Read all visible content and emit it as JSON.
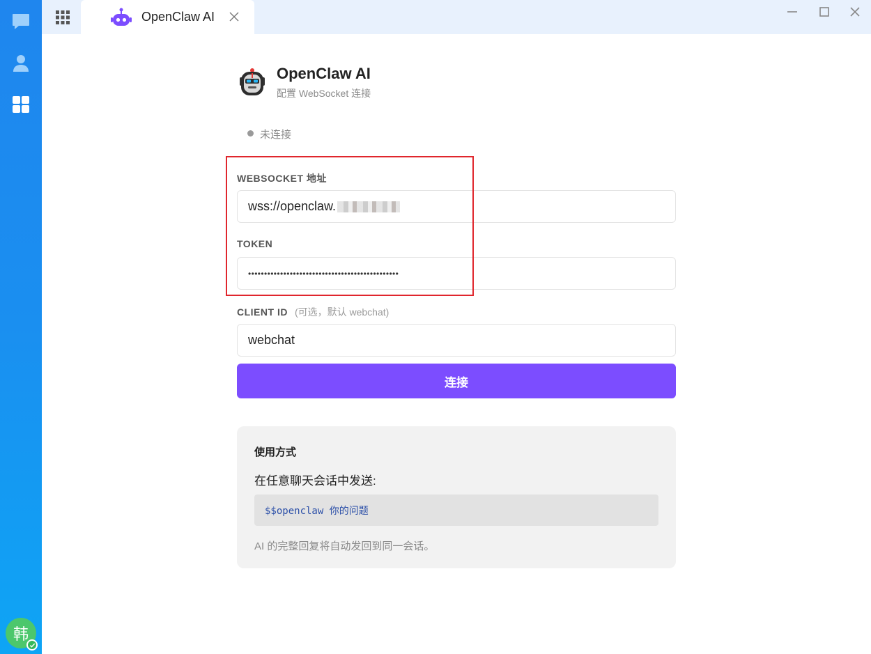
{
  "rail": {
    "items": [
      {
        "name": "chat-icon"
      },
      {
        "name": "contacts-icon"
      },
      {
        "name": "apps-icon"
      }
    ],
    "avatar_text": "韩",
    "accent_color": "#1a8ff0"
  },
  "tab": {
    "title": "OpenClaw AI",
    "icon": "robot-icon"
  },
  "header": {
    "title": "OpenClaw AI",
    "subtitle": "配置 WebSocket 连接"
  },
  "status": {
    "text": "未连接",
    "color": "#9a9a9a"
  },
  "form": {
    "websocket": {
      "label": "WEBSOCKET 地址",
      "value": "wss://openclaw."
    },
    "token": {
      "label": "TOKEN",
      "value": "•••••••••••••••••••••••••••••••••••••••••••••••"
    },
    "client_id": {
      "label": "CLIENT ID",
      "hint": "(可选，默认 webchat)",
      "value": "webchat"
    },
    "connect_label": "连接",
    "button_color": "#7c4dff"
  },
  "usage": {
    "title": "使用方式",
    "desc": "在任意聊天会话中发送:",
    "code": "$$openclaw 你的问题",
    "note": "AI 的完整回复将自动发回到同一会话。"
  }
}
